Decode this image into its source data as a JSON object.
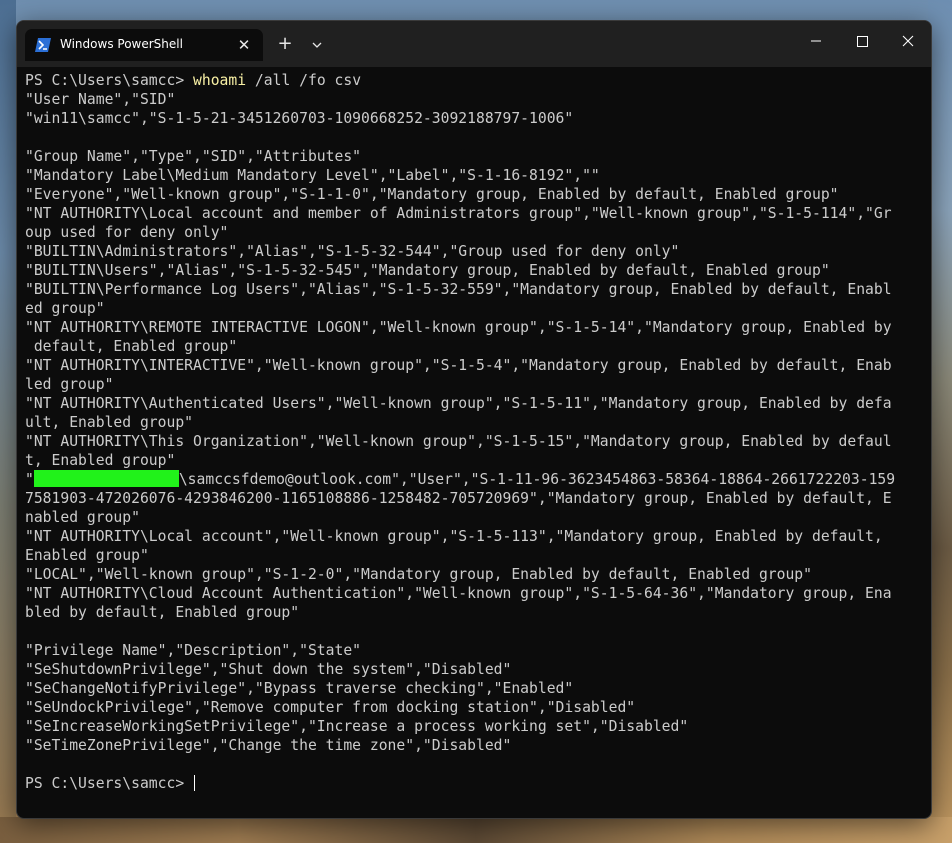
{
  "window": {
    "tab_title": "Windows PowerShell",
    "tab_close_glyph": "✕",
    "new_tab_glyph": "+",
    "colors": {
      "background": "#0c0c0c",
      "titlebar": "#202020",
      "text": "#cccccc",
      "command": "#f9f1a5",
      "redaction": "#21f21a"
    }
  },
  "terminal": {
    "prompt1": "PS C:\\Users\\samcc> ",
    "cmd_name": "whoami",
    "cmd_args": " /all /fo csv",
    "user_header": "\"User Name\",\"SID\"",
    "user_row": "\"win11\\samcc\",\"S-1-5-21-3451260703-1090668252-3092188797-1006\"",
    "group_header": "\"Group Name\",\"Type\",\"SID\",\"Attributes\"",
    "group_lines_a": [
      "\"Mandatory Label\\Medium Mandatory Level\",\"Label\",\"S-1-16-8192\",\"\"",
      "\"Everyone\",\"Well-known group\",\"S-1-1-0\",\"Mandatory group, Enabled by default, Enabled group\"",
      "\"NT AUTHORITY\\Local account and member of Administrators group\",\"Well-known group\",\"S-1-5-114\",\"Gr",
      "oup used for deny only\"",
      "\"BUILTIN\\Administrators\",\"Alias\",\"S-1-5-32-544\",\"Group used for deny only\"",
      "\"BUILTIN\\Users\",\"Alias\",\"S-1-5-32-545\",\"Mandatory group, Enabled by default, Enabled group\"",
      "\"BUILTIN\\Performance Log Users\",\"Alias\",\"S-1-5-32-559\",\"Mandatory group, Enabled by default, Enabl",
      "ed group\"",
      "\"NT AUTHORITY\\REMOTE INTERACTIVE LOGON\",\"Well-known group\",\"S-1-5-14\",\"Mandatory group, Enabled by",
      " default, Enabled group\"",
      "\"NT AUTHORITY\\INTERACTIVE\",\"Well-known group\",\"S-1-5-4\",\"Mandatory group, Enabled by default, Enab",
      "led group\"",
      "\"NT AUTHORITY\\Authenticated Users\",\"Well-known group\",\"S-1-5-11\",\"Mandatory group, Enabled by defa",
      "ult, Enabled group\"",
      "\"NT AUTHORITY\\This Organization\",\"Well-known group\",\"S-1-5-15\",\"Mandatory group, Enabled by defaul",
      "t, Enabled group\""
    ],
    "redacted_quote": "\"",
    "redacted_rest": "\\samccsfdemo@outlook.com\",\"User\",\"S-1-11-96-3623454863-58364-18864-2661722203-159",
    "group_lines_b": [
      "7581903-472026076-4293846200-1165108886-1258482-705720969\",\"Mandatory group, Enabled by default, E",
      "nabled group\"",
      "\"NT AUTHORITY\\Local account\",\"Well-known group\",\"S-1-5-113\",\"Mandatory group, Enabled by default,",
      "Enabled group\"",
      "\"LOCAL\",\"Well-known group\",\"S-1-2-0\",\"Mandatory group, Enabled by default, Enabled group\"",
      "\"NT AUTHORITY\\Cloud Account Authentication\",\"Well-known group\",\"S-1-5-64-36\",\"Mandatory group, Ena",
      "bled by default, Enabled group\""
    ],
    "priv_header": "\"Privilege Name\",\"Description\",\"State\"",
    "priv_lines": [
      "\"SeShutdownPrivilege\",\"Shut down the system\",\"Disabled\"",
      "\"SeChangeNotifyPrivilege\",\"Bypass traverse checking\",\"Enabled\"",
      "\"SeUndockPrivilege\",\"Remove computer from docking station\",\"Disabled\"",
      "\"SeIncreaseWorkingSetPrivilege\",\"Increase a process working set\",\"Disabled\"",
      "\"SeTimeZonePrivilege\",\"Change the time zone\",\"Disabled\""
    ],
    "prompt2": "PS C:\\Users\\samcc> "
  }
}
